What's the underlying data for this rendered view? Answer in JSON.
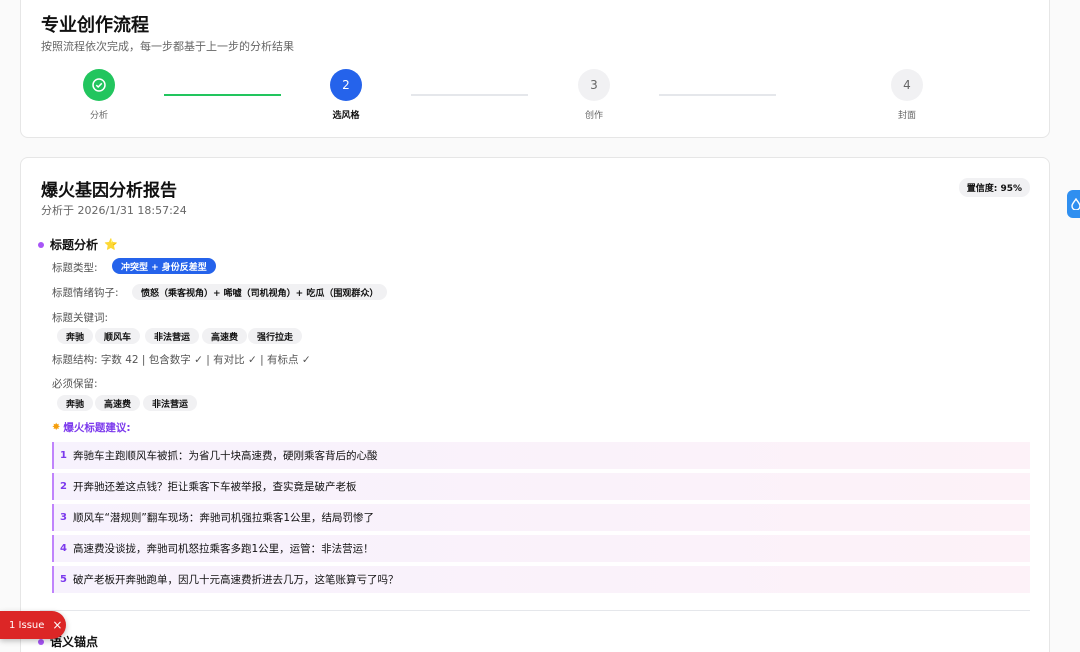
{
  "workflow": {
    "title": "专业创作流程",
    "subtitle": "按照流程依次完成，每一步都基于上一步的分析结果",
    "steps": [
      {
        "label": "分析",
        "number": "",
        "state": "done"
      },
      {
        "label": "选风格",
        "number": "2",
        "state": "active"
      },
      {
        "label": "创作",
        "number": "3",
        "state": "pending"
      },
      {
        "label": "封面",
        "number": "4",
        "state": "pending"
      }
    ]
  },
  "report": {
    "title": "爆火基因分析报告",
    "analyzed_at": "分析于 2026/1/31 18:57:24",
    "confidence": "置信度: 95%",
    "title_analysis": {
      "heading": "标题分析",
      "star": "⭐",
      "type_label": "标题类型:",
      "type_value": "冲突型 + 身份反差型",
      "hook_label": "标题情绪钩子:",
      "hook_value": "愤怒（乘客视角）+ 唏嘘（司机视角）+ 吃瓜（围观群众）",
      "keywords_label": "标题关键词:",
      "keywords": [
        "奔驰",
        "顺风车",
        "非法营运",
        "高速费",
        "强行拉走"
      ],
      "structure": "标题结构: 字数 42 | 包含数字 ✓ | 有对比 ✓ | 有标点 ✓",
      "must_keep_label": "必须保留:",
      "must_keep": [
        "奔驰",
        "高速费",
        "非法营运"
      ],
      "suggestions_label": "爆火标题建议:",
      "suggestions": [
        {
          "n": "1",
          "text": "奔驰车主跑顺风车被抓：为省几十块高速费，硬刚乘客背后的心酸"
        },
        {
          "n": "2",
          "text": "开奔驰还差这点钱？拒让乘客下车被举报，查实竟是破产老板"
        },
        {
          "n": "3",
          "text": "顺风车“潜规则”翻车现场：奔驰司机强拉乘客1公里，结局罚惨了"
        },
        {
          "n": "4",
          "text": "高速费没谈拢，奔驰司机怒拉乘客多跑1公里，运管：非法营运！"
        },
        {
          "n": "5",
          "text": "破产老板开奔驰跑单，因几十元高速费折进去几万，这笔账算亏了吗？"
        }
      ]
    },
    "semantic_anchor": {
      "heading": "语义锚点"
    }
  },
  "issue_badge": {
    "label": "1 Issue",
    "close": "×"
  },
  "colors": {
    "green": "#22c55e",
    "blue": "#2563eb",
    "purple": "#a855f7",
    "red": "#dc2626"
  }
}
